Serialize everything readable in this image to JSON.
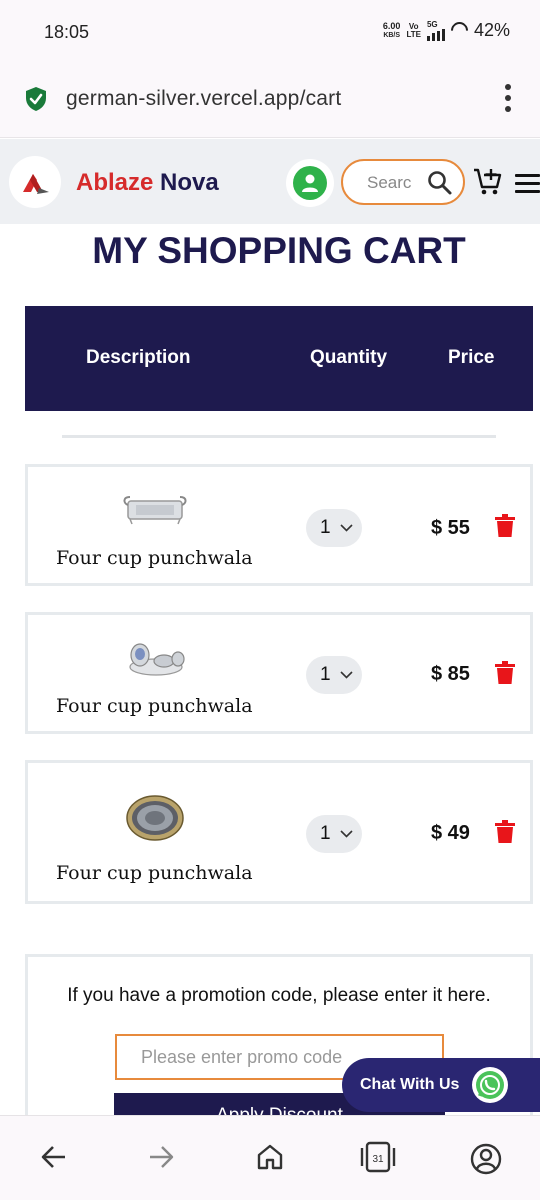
{
  "status_bar": {
    "time": "18:05",
    "speed_value": "6.00",
    "speed_unit": "KB/S",
    "volte_top": "Vo",
    "volte_bottom": "LTE",
    "network": "5G",
    "battery": "42%"
  },
  "browser": {
    "url": "german-silver.vercel.app/cart",
    "secure_icon": "shield-check-icon",
    "menu_icon": "kebab-menu-icon",
    "tab_count": "31"
  },
  "header": {
    "brand_first": "Ablaze",
    "brand_second": "Nova",
    "search_placeholder": "Searc",
    "accent_color": "#e78a3c",
    "brand_color": "#1e1a4e",
    "brand_red": "#d62b2b"
  },
  "cart": {
    "title": "MY SHOPPING CART",
    "columns": [
      "Description",
      "Quantity",
      "Price"
    ],
    "items": [
      {
        "name": "Four cup punchwala",
        "quantity": "1",
        "price": "$ 55",
        "image_icon": "silver-tray-icon"
      },
      {
        "name": "Four cup punchwala",
        "quantity": "1",
        "price": "$ 85",
        "image_icon": "silver-cup-set-icon"
      },
      {
        "name": "Four cup punchwala",
        "quantity": "1",
        "price": "$ 49",
        "image_icon": "silver-plate-icon"
      }
    ],
    "delete_color": "#e8151a"
  },
  "promo": {
    "text": "If you have a promotion code, please enter it here.",
    "placeholder": "Please enter promo code",
    "button": "Apply Discount"
  },
  "chat": {
    "label": "Chat With Us",
    "icon": "whatsapp-icon"
  },
  "nav": {
    "icons": [
      "back-arrow-icon",
      "forward-arrow-icon",
      "home-icon",
      "tabs-icon",
      "account-icon"
    ]
  }
}
